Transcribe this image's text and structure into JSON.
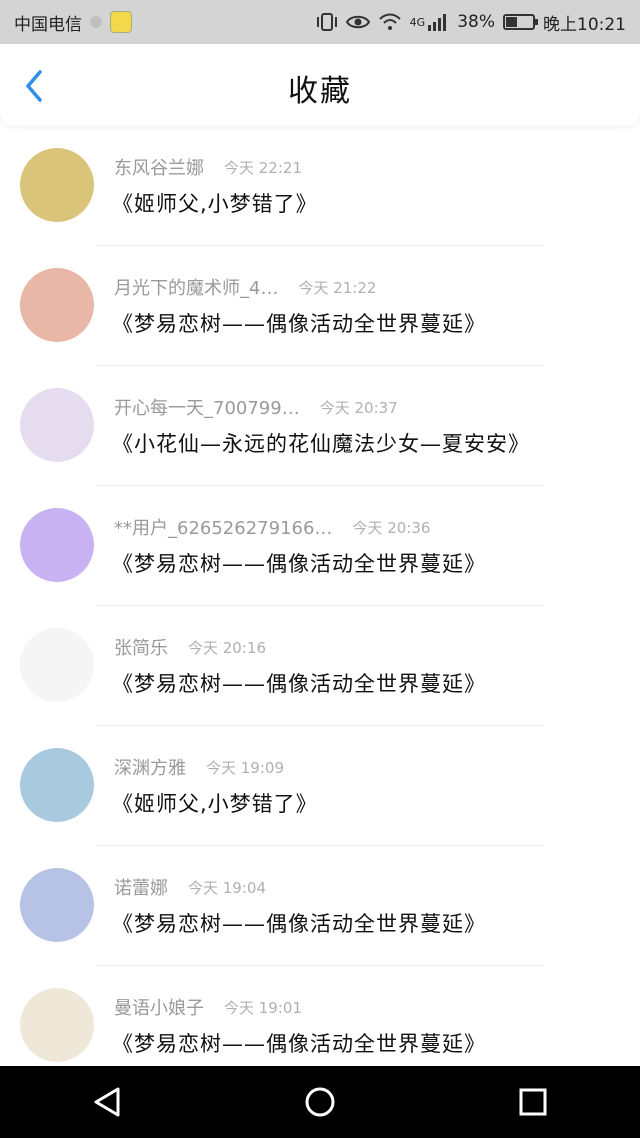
{
  "status_bar": {
    "carrier": "中国电信",
    "network": "4G",
    "battery_percent": "38%",
    "battery_level": 0.38,
    "time": "晚上10:21"
  },
  "header": {
    "title": "收藏"
  },
  "items": [
    {
      "user": "东风谷兰娜",
      "time": "今天 22:21",
      "message": "《姬师父,小梦错了》",
      "avatar_color": "#d9c47a"
    },
    {
      "user": "月光下的魔术师_4…",
      "time": "今天 21:22",
      "message": "《梦易恋树——偶像活动全世界蔓延》",
      "avatar_color": "#e8b7a8"
    },
    {
      "user": "开心每一天_700799…",
      "time": "今天 20:37",
      "message": "《小花仙—永远的花仙魔法少女—夏安安》",
      "avatar_color": "#e6dcef"
    },
    {
      "user": "**用户_626526279166…",
      "time": "今天 20:36",
      "message": "《梦易恋树——偶像活动全世界蔓延》",
      "avatar_color": "#c8b2f2"
    },
    {
      "user": "张简乐",
      "time": "今天 20:16",
      "message": "《梦易恋树——偶像活动全世界蔓延》",
      "avatar_color": "#f5f5f5"
    },
    {
      "user": "深渊方雅",
      "time": "今天 19:09",
      "message": "《姬师父,小梦错了》",
      "avatar_color": "#a9c9de"
    },
    {
      "user": "诺蕾娜",
      "time": "今天 19:04",
      "message": "《梦易恋树——偶像活动全世界蔓延》",
      "avatar_color": "#b7c3e6"
    },
    {
      "user": "曼语小娘子",
      "time": "今天 19:01",
      "message": "《梦易恋树——偶像活动全世界蔓延》",
      "avatar_color": "#efe8d8"
    }
  ]
}
